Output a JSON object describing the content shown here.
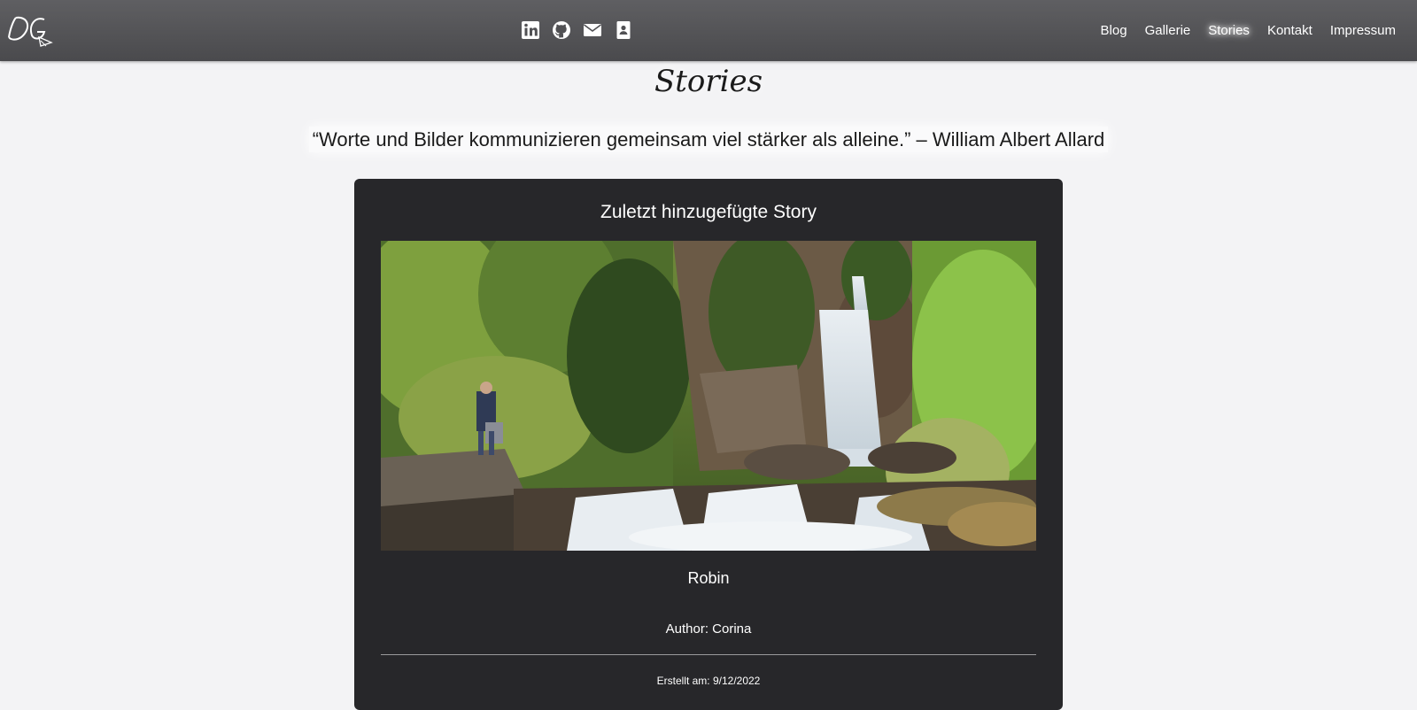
{
  "header": {
    "logo_text": "DG",
    "social_icons": [
      "linkedin-icon",
      "github-icon",
      "envelope-icon",
      "contact-card-icon"
    ],
    "nav": [
      {
        "label": "Blog",
        "active": false
      },
      {
        "label": "Gallerie",
        "active": false
      },
      {
        "label": "Stories",
        "active": true
      },
      {
        "label": "Kontakt",
        "active": false
      },
      {
        "label": "Impressum",
        "active": false
      }
    ]
  },
  "page": {
    "title": "Stories",
    "quote": "“Worte und Bilder kommunizieren gemeinsam viel stärker als alleine.” – William Albert Allard"
  },
  "latest_story": {
    "heading": "Zuletzt hinzugefügte Story",
    "title": "Robin",
    "author": "Author: Corina",
    "created": "Erstellt am: 9/12/2022"
  },
  "colors": {
    "navbar": "#545457",
    "background": "#f3f3f5",
    "card": "#27272a",
    "text_light": "#ffffff"
  }
}
